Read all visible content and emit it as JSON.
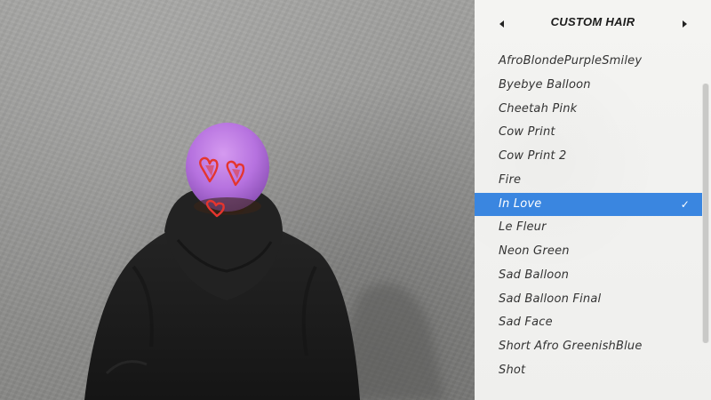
{
  "menu": {
    "title": "CUSTOM HAIR",
    "items": [
      {
        "label": "AfroBlondePurpleSmiley"
      },
      {
        "label": "Byebye Balloon"
      },
      {
        "label": "Cheetah Pink"
      },
      {
        "label": "Cow Print"
      },
      {
        "label": "Cow Print 2"
      },
      {
        "label": "Fire"
      },
      {
        "label": "In Love"
      },
      {
        "label": "Le Fleur"
      },
      {
        "label": "Neon Green"
      },
      {
        "label": "Sad Balloon"
      },
      {
        "label": "Sad Balloon Final"
      },
      {
        "label": "Sad Face"
      },
      {
        "label": "Short Afro GreenishBlue"
      },
      {
        "label": "Shot"
      }
    ],
    "selected_index": 6,
    "check_glyph": "✓"
  },
  "colors": {
    "accent": "#3a86e0",
    "hair": "#c07de6",
    "hoodie": "#1f1f1f",
    "wall": "#979795"
  },
  "icons": {
    "prev": "triangle-left-icon",
    "next": "triangle-right-icon",
    "selected": "checkmark-icon"
  }
}
